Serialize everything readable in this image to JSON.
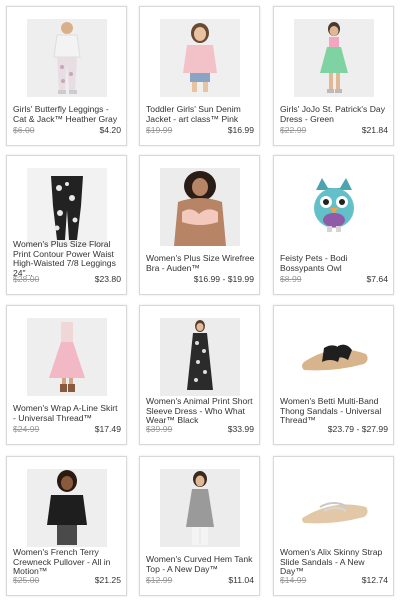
{
  "products": [
    {
      "title": "Girls' Butterfly Leggings - Cat & Jack™ Heather Gray",
      "original_price": "$6.00",
      "price": "$4.20",
      "image_icon": "leggings-kid-image"
    },
    {
      "title": "Toddler Girls' Sun Denim Jacket - art class™ Pink",
      "original_price": "$19.99",
      "price": "$16.99",
      "image_icon": "girl-pink-jacket-image"
    },
    {
      "title": "Girls' JoJo St. Patrick's Day Dress - Green",
      "original_price": "$22.99",
      "price": "$21.84",
      "image_icon": "girl-green-dress-image"
    },
    {
      "title": "Women's Plus Size Floral Print Contour Power Waist High-Waisted 7/8 Leggings 24\"...",
      "original_price": "$28.00",
      "price": "$23.80",
      "image_icon": "floral-leggings-image"
    },
    {
      "title": "Women's Plus Size Wirefree Bra - Auden™",
      "original_price": "",
      "price": "$16.99 - $19.99",
      "image_icon": "bra-model-image"
    },
    {
      "title": "Feisty Pets - Bodi Bossypants Owl",
      "original_price": "$8.99",
      "price": "$7.64",
      "image_icon": "owl-plush-image"
    },
    {
      "title": "Women's Wrap A-Line Skirt - Universal Thread™",
      "original_price": "$24.99",
      "price": "$17.49",
      "image_icon": "pink-skirt-image"
    },
    {
      "title": "Women's Animal Print Short Sleeve Dress - Who What Wear™ Black",
      "original_price": "$39.99",
      "price": "$33.99",
      "image_icon": "animal-print-dress-image"
    },
    {
      "title": "Women's Betti Multi-Band Thong Sandals - Universal Thread™",
      "original_price": "",
      "price": "$23.79 - $27.99",
      "image_icon": "black-sandal-image"
    },
    {
      "title": "Women's French Terry Crewneck Pullover - All in Motion™",
      "original_price": "$25.00",
      "price": "$21.25",
      "image_icon": "black-pullover-image"
    },
    {
      "title": "Women's Curved Hem Tank Top - A New Day™",
      "original_price": "$12.99",
      "price": "$11.04",
      "image_icon": "tank-top-image"
    },
    {
      "title": "Women's Alix Skinny Strap Slide Sandals - A New Day™",
      "original_price": "$14.99",
      "price": "$12.74",
      "image_icon": "slide-sandal-image"
    }
  ]
}
